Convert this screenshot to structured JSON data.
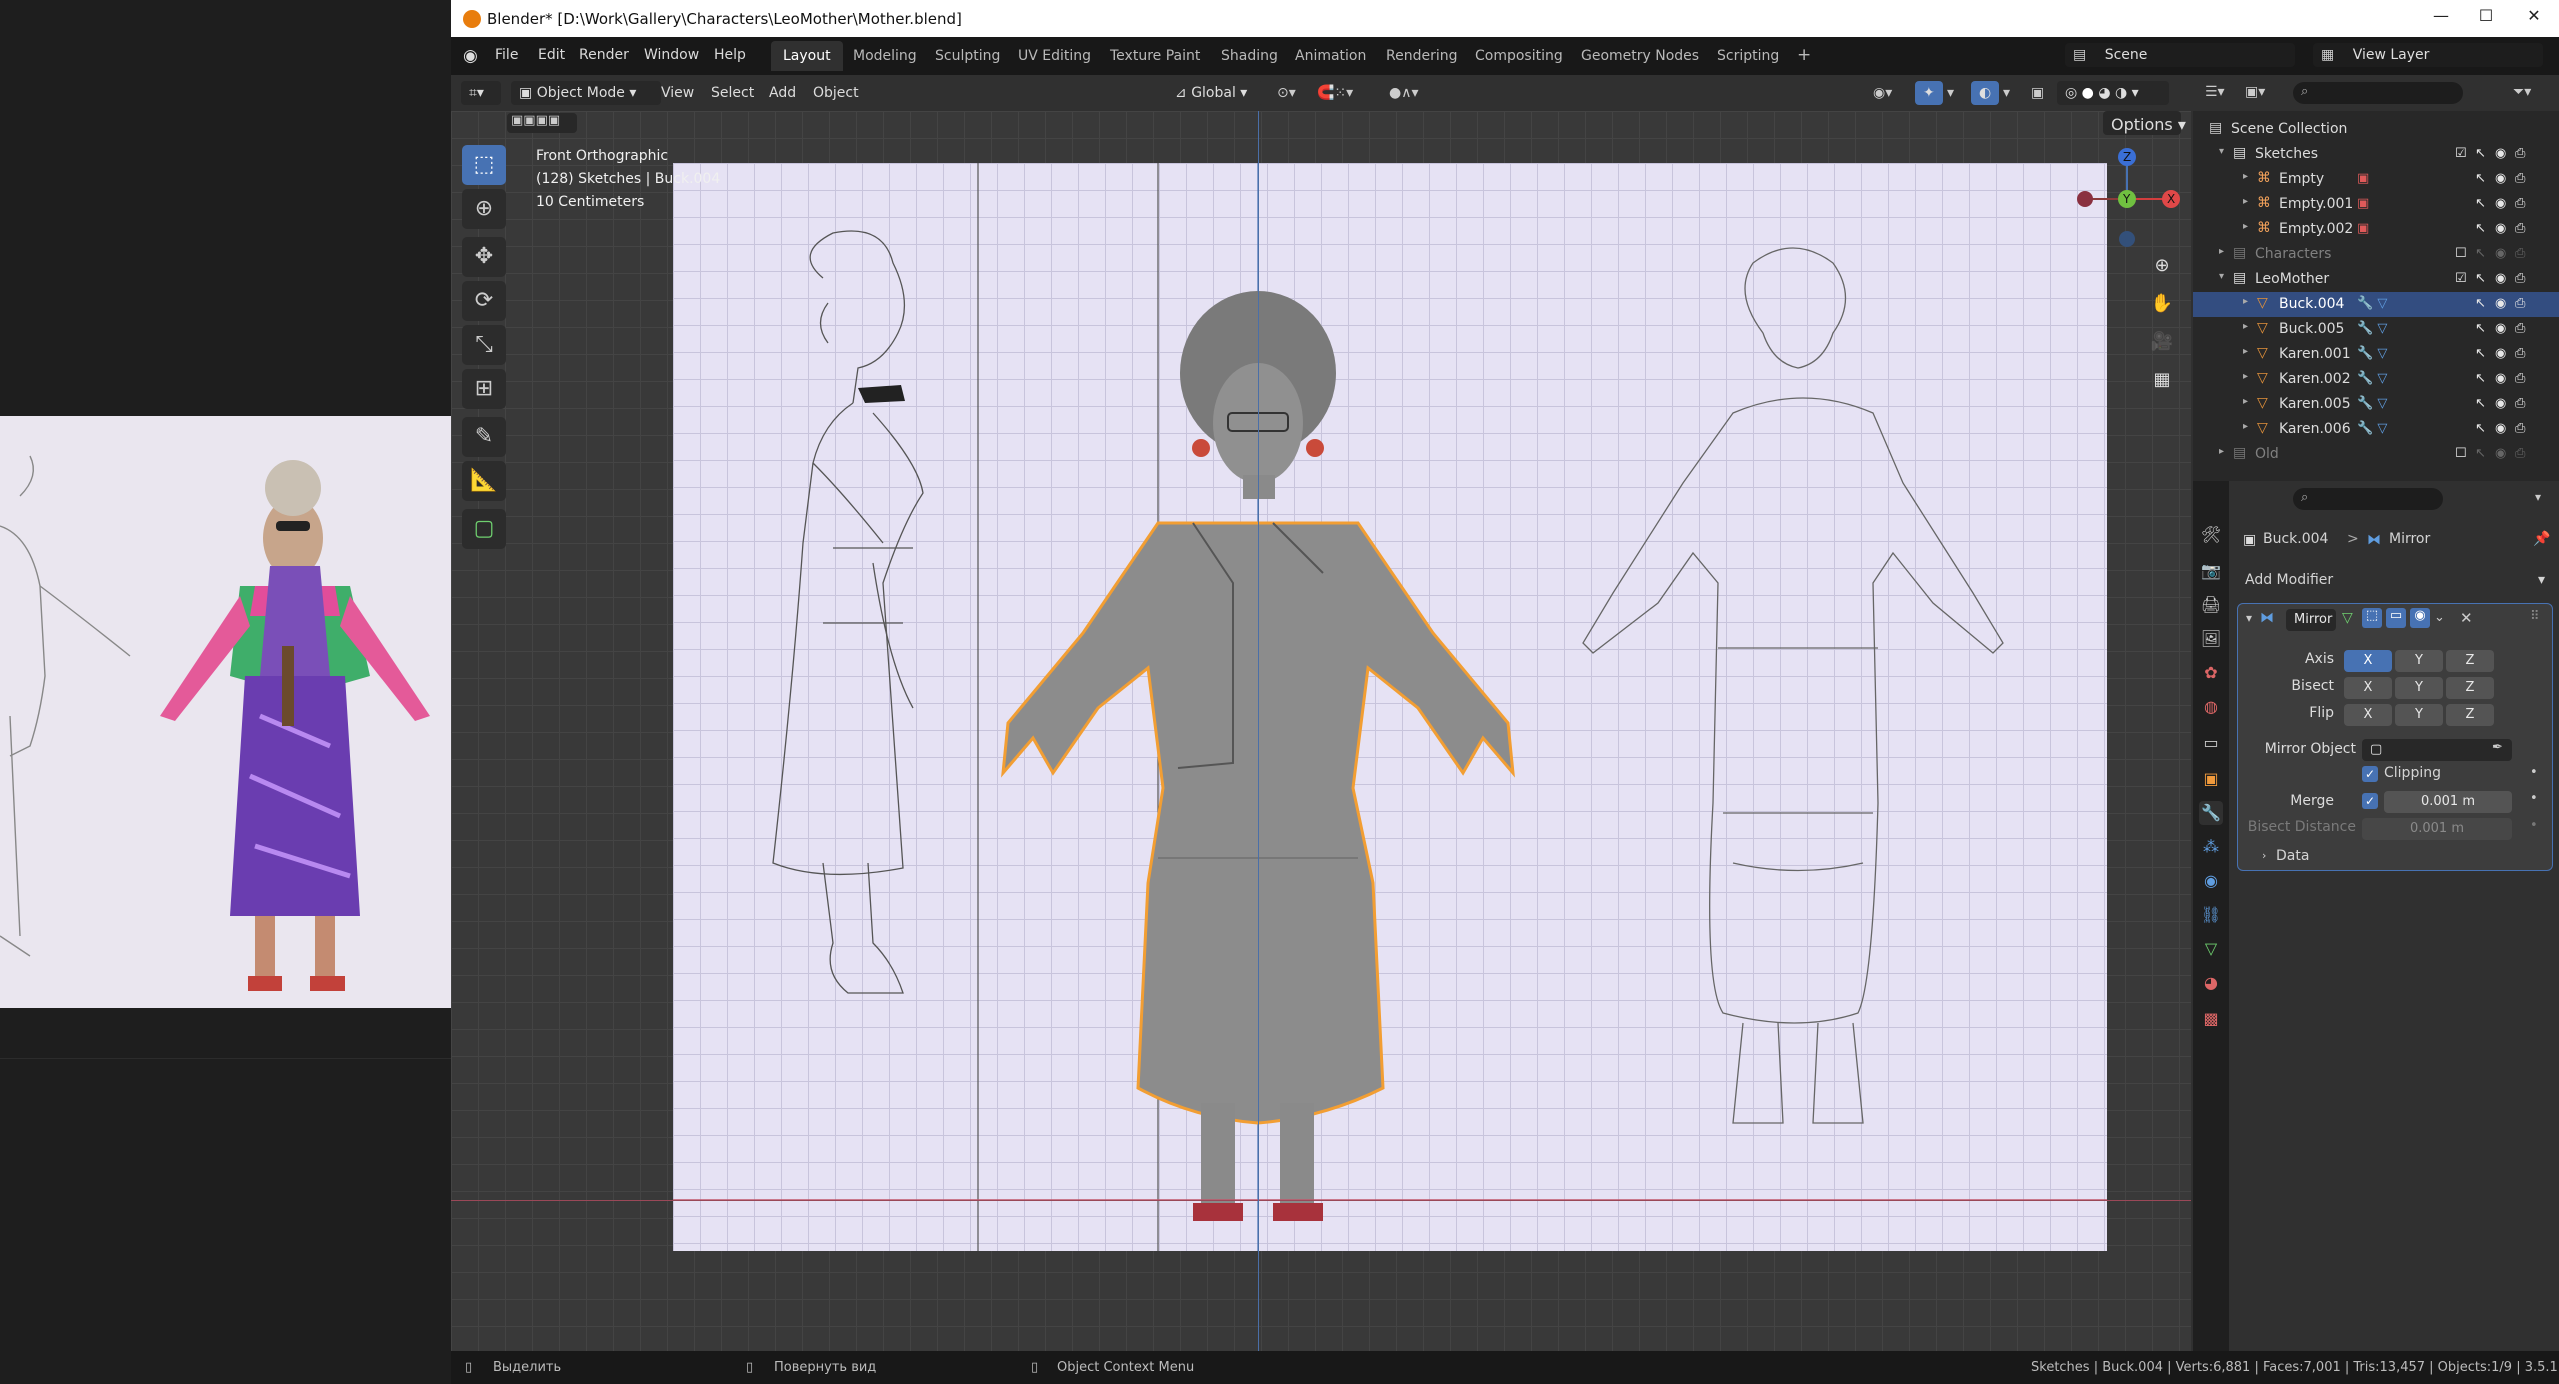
{
  "window": {
    "title": "Blender* [D:\\Work\\Gallery\\Characters\\LeoMother\\Mother.blend]",
    "controls": [
      "—",
      "☐",
      "✕"
    ]
  },
  "menubar": {
    "items": [
      "File",
      "Edit",
      "Render",
      "Window",
      "Help"
    ],
    "workspaces": [
      "Layout",
      "Modeling",
      "Sculpting",
      "UV Editing",
      "Texture Paint",
      "Shading",
      "Animation",
      "Rendering",
      "Compositing",
      "Geometry Nodes",
      "Scripting"
    ],
    "active_workspace": "Layout",
    "add": "+",
    "scene": "Scene",
    "view_layer": "View Layer"
  },
  "viewport_header": {
    "mode": "Object Mode",
    "menus": [
      "View",
      "Select",
      "Add",
      "Object"
    ],
    "transform": "Global",
    "options": "Options"
  },
  "viewport": {
    "overlay_lines": [
      "Front Orthographic",
      "(128) Sketches | Buck.004",
      "10 Centimeters"
    ],
    "gizmo": {
      "z": "Z",
      "y": "Y",
      "x": "X"
    }
  },
  "outliner": {
    "rows": [
      {
        "label": "Scene Collection",
        "depth": 0,
        "type": "scene",
        "state": "normal"
      },
      {
        "label": "Sketches",
        "depth": 1,
        "type": "collection",
        "state": "normal",
        "expanded": true
      },
      {
        "label": "Empty",
        "depth": 2,
        "type": "empty",
        "state": "normal"
      },
      {
        "label": "Empty.001",
        "depth": 2,
        "type": "empty",
        "state": "normal"
      },
      {
        "label": "Empty.002",
        "depth": 2,
        "type": "empty",
        "state": "normal"
      },
      {
        "label": "Characters",
        "depth": 1,
        "type": "collection",
        "state": "dim"
      },
      {
        "label": "LeoMother",
        "depth": 1,
        "type": "collection",
        "state": "normal",
        "expanded": true
      },
      {
        "label": "Buck.004",
        "depth": 2,
        "type": "mesh",
        "state": "selected"
      },
      {
        "label": "Buck.005",
        "depth": 2,
        "type": "mesh",
        "state": "normal"
      },
      {
        "label": "Karen.001",
        "depth": 2,
        "type": "mesh",
        "state": "normal"
      },
      {
        "label": "Karen.002",
        "depth": 2,
        "type": "mesh",
        "state": "normal"
      },
      {
        "label": "Karen.005",
        "depth": 2,
        "type": "mesh",
        "state": "normal"
      },
      {
        "label": "Karen.006",
        "depth": 2,
        "type": "mesh",
        "state": "normal"
      },
      {
        "label": "Old",
        "depth": 1,
        "type": "collection",
        "state": "dim"
      }
    ]
  },
  "properties": {
    "breadcrumb_object": "Buck.004",
    "breadcrumb_sep": ">",
    "breadcrumb_modifier": "Mirror",
    "add_modifier": "Add Modifier",
    "modifier_name": "Mirror",
    "axis_label": "Axis",
    "bisect_label": "Bisect",
    "flip_label": "Flip",
    "xyz": [
      "X",
      "Y",
      "Z"
    ],
    "mirror_object_label": "Mirror Object",
    "clipping_label": "Clipping",
    "clipping_checked": true,
    "merge_label": "Merge",
    "merge_value": "0.001 m",
    "merge_checked": true,
    "bisect_distance_label": "Bisect Distance",
    "bisect_distance_value": "0.001 m",
    "data_label": "Data"
  },
  "statusbar": {
    "left": "Выделить",
    "mid": "Повернуть вид",
    "right": "Object Context Menu",
    "stats": "Sketches | Buck.004 | Verts:6,881 | Faces:7,001 | Tris:13,457 | Objects:1/9 | 3.5.1"
  },
  "colors": {
    "accent": "#4772b3",
    "selection": "#334d80",
    "object_outline": "#f29e33",
    "mesh_icon": "#e2913a",
    "sheet": "#e6e2f4"
  }
}
